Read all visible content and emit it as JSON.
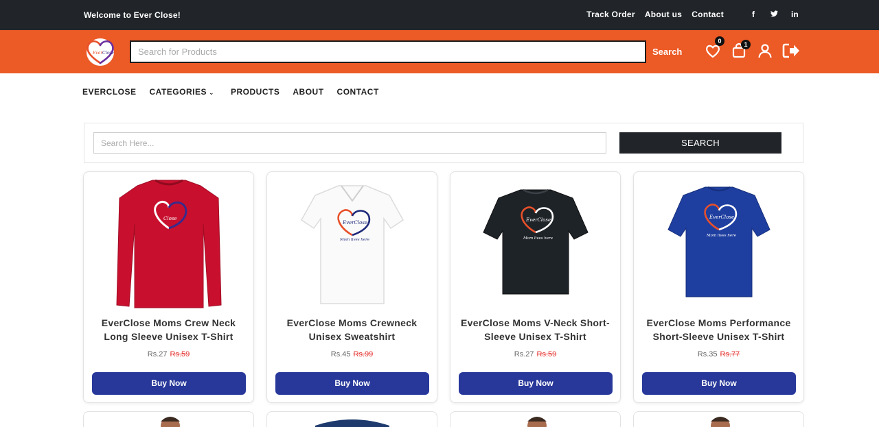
{
  "topbar": {
    "welcome": "Welcome to Ever Close!",
    "links": [
      "Track Order",
      "About us",
      "Contact"
    ],
    "social": [
      "f",
      "t",
      "in"
    ]
  },
  "header": {
    "logo_text": "Ever Close",
    "search_placeholder": "Search for Products",
    "search_label": "Search",
    "wishlist_count": "0",
    "cart_count": "1"
  },
  "nav": {
    "items": [
      "EVERCLOSE",
      "CATEGORIES",
      "PRODUCTS",
      "ABOUT",
      "CONTACT"
    ]
  },
  "search_panel": {
    "placeholder": "Search Here...",
    "button": "SEARCH"
  },
  "products": [
    {
      "title": "EverClose Moms Crew Neck Long Sleeve Unisex T-Shirt",
      "price": "Rs.27",
      "old_price": "Rs.59",
      "button": "Buy Now",
      "color": "#c8102e"
    },
    {
      "title": "EverClose Moms Crewneck Unisex Sweatshirt",
      "price": "Rs.45",
      "old_price": "Rs.99",
      "button": "Buy Now",
      "color": "#ffffff"
    },
    {
      "title": "EverClose Moms V-Neck Short-Sleeve Unisex T-Shirt",
      "price": "Rs.27",
      "old_price": "Rs.59",
      "button": "Buy Now",
      "color": "#1e2328"
    },
    {
      "title": "EverClose Moms Performance Short-Sleeve Unisex T-Shirt",
      "price": "Rs.35",
      "old_price": "Rs.77",
      "button": "Buy Now",
      "color": "#1f3fa0"
    }
  ],
  "colors": {
    "topbar": "#212529",
    "header": "#ec5a26",
    "button": "#27389a",
    "old_price": "#e53935"
  }
}
